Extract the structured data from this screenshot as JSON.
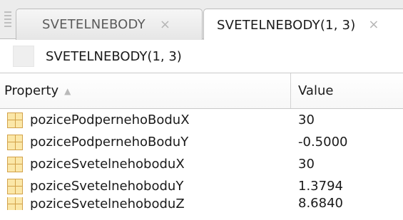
{
  "tabs": [
    {
      "label": "SVETELNEBODY",
      "close": "×",
      "active": false
    },
    {
      "label": "SVETELNEBODY(1, 3)",
      "close": "×",
      "active": true
    }
  ],
  "variable": {
    "name": "SVETELNEBODY(1, 3)"
  },
  "table": {
    "headers": {
      "property": "Property",
      "value": "Value",
      "sort_glyph": "▲"
    },
    "rows": [
      {
        "property": "pozicePodpernehoBoduX",
        "value": "30"
      },
      {
        "property": "pozicePodpernehoBoduY",
        "value": "-0.5000"
      },
      {
        "property": "poziceSvetelnehoboduX",
        "value": "30"
      },
      {
        "property": "poziceSvetelnehoboduY",
        "value": "1.3794"
      },
      {
        "property": "poziceSvetelnehoboduZ",
        "value": "8.6840"
      }
    ]
  },
  "icons": {
    "grip": "drag-grip-icon",
    "property": "grid-property-icon"
  },
  "colors": {
    "icon_fill": "#fbe7a8",
    "icon_border": "#d2a24a",
    "tab_close": "#b5b5b5"
  }
}
